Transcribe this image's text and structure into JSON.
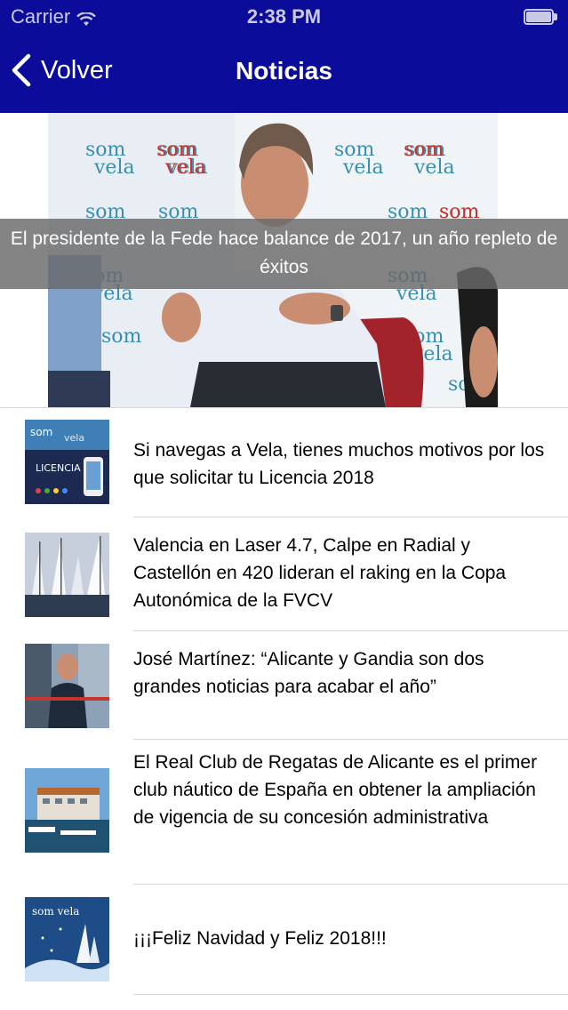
{
  "status_bar": {
    "carrier": "Carrier",
    "time": "2:38 PM",
    "wifi_icon": "wifi-icon",
    "battery_icon": "battery-icon"
  },
  "nav": {
    "back_label": "Volver",
    "back_icon": "chevron-left-icon",
    "title": "Noticias",
    "bar_color": "#0c0c9a"
  },
  "featured": {
    "caption": "El presidente de la Fede hace balance de 2017, un año repleto de éxitos",
    "backdrop_text": "som vela"
  },
  "news": [
    {
      "title": "Si navegas a Vela, tienes muchos motivos por los que solicitar tu Licencia 2018",
      "thumb_text": "LICENCIA"
    },
    {
      "title": "Valencia en Laser 4.7, Calpe en Radial y Castellón en 420 lideran el raking en la Copa Autonómica de la FVCV"
    },
    {
      "title": "José Martínez: “Alicante y Gandia son dos grandes noticias para acabar el año”"
    },
    {
      "title": "El Real Club de Regatas de Alicante es el primer club náutico de España en obtener la ampliación de vigencia de su concesión administrativa"
    },
    {
      "title": "¡¡¡Feliz Navidad y Feliz 2018!!!",
      "thumb_text": "som vela"
    }
  ]
}
